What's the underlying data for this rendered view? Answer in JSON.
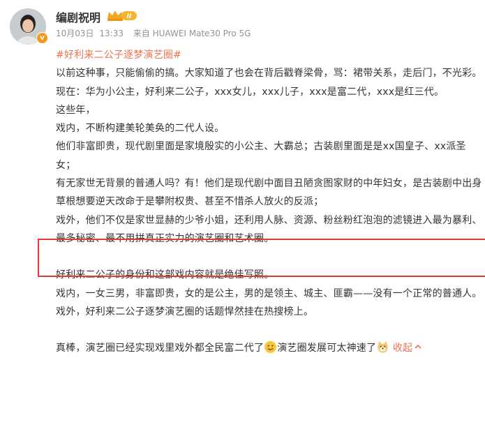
{
  "author": {
    "name": "编剧祝明",
    "badge_text": "II",
    "verified_letter": "v"
  },
  "meta": {
    "date": "10月03日",
    "time": "13:33",
    "source": "来自 HUAWEI Mate30 Pro 5G"
  },
  "post": {
    "topic": "#好利来二公子逐梦演艺圈#",
    "p1": "以前这种事，只能偷偷的搞。大家知道了也会在背后戳脊梁骨，骂：裙带关系，走后门，不光彩。",
    "p2a": "现在：华为小公主，好利来二公子，xxx女儿，xxx儿子，xxx是富二代，xxx是红三代。",
    "p2b": "这些年，",
    "p3": "戏内，不断构建美轮美奂的二代人设。",
    "p4": "他们非富即贵，现代剧里面是家境殷实的小公主、大霸总；古装剧里面是是xx国皇子、xx派圣女；",
    "p5": "有无家世无背景的普通人吗？有！他们是现代剧中面目丑陋贪图家财的中年妇女，是古装剧中出身草根想要逆天改命于是攀附权贵、甚至不惜杀人放火的反派；",
    "p6": "戏外，他们不仅是家世显赫的少爷小姐，还利用人脉、资源、粉丝粉红泡泡的滤镜进入最为暴利、最多秘密、最不用拼真正实力的演艺圈和艺术圈。",
    "p7": "好利来二公子的身份和这部戏内容就是绝佳写照。",
    "p8": "戏内，一女三男，非富即贵，女的是公主，男的是领主、城主、匪霸——没有一个正常的普通人。",
    "p9": "戏外，好利来二公子逐梦演艺圈的话题悍然挂在热搜榜上。",
    "p10a": "真棒，演艺圈已经实现戏里戏外都全民富二代了",
    "p10b": "演艺圈发展可太神速了",
    "collapse": "收起",
    "collapse_icon": "chevron-up"
  },
  "colors": {
    "topic": "#eb7350",
    "highlight_border": "#e53935",
    "meta": "#939393"
  }
}
